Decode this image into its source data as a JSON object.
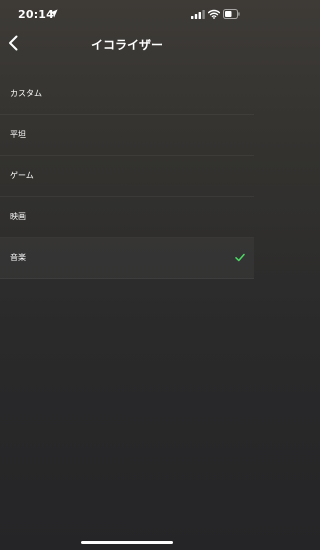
{
  "status_bar": {
    "time": "20:14"
  },
  "nav": {
    "title": "イコライザー"
  },
  "presets": [
    {
      "label": "カスタム",
      "selected": false
    },
    {
      "label": "平坦",
      "selected": false
    },
    {
      "label": "ゲーム",
      "selected": false
    },
    {
      "label": "映画",
      "selected": false
    },
    {
      "label": "音楽",
      "selected": true
    }
  ],
  "colors": {
    "check": "#4cd964",
    "text": "#ffffff"
  },
  "icons": {
    "location": "location-arrow-icon",
    "signal": "cellular-signal-icon",
    "wifi": "wifi-icon",
    "battery": "battery-icon",
    "back": "chevron-left-icon",
    "selected": "checkmark-icon"
  }
}
